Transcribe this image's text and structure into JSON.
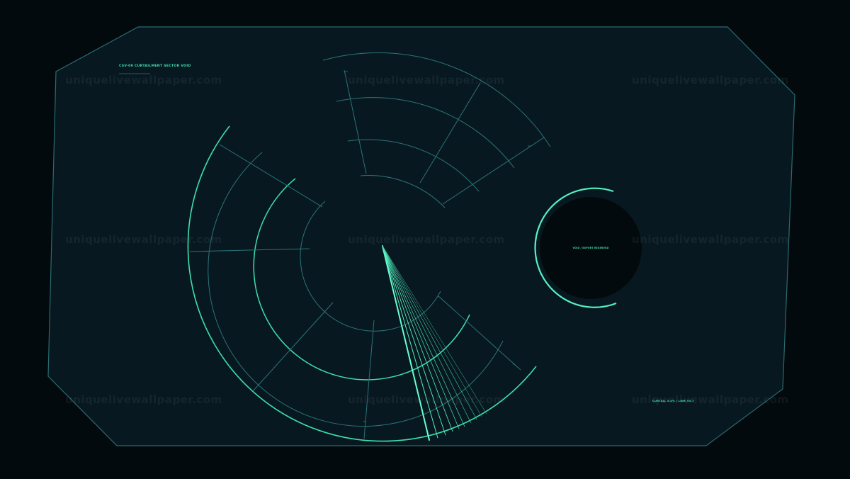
{
  "panel": {
    "title": "CSV-09 CURTAILMENT SECTOR VOID",
    "footer_readout": "CURTAIL 3.4% / LINK 93.7",
    "colors": {
      "background": "#030a0d",
      "panel_fill": "#081820",
      "panel_stroke": "#2a6a6e",
      "accent": "#3ee0ae",
      "accent_bright": "#66ffd0",
      "grid": "#2a7478",
      "void": "#030a0d"
    }
  },
  "void_circle": {
    "label": "VOID / EXPORT RESERVED"
  },
  "watermark": {
    "text": "uniquelivewallpaper.com"
  }
}
